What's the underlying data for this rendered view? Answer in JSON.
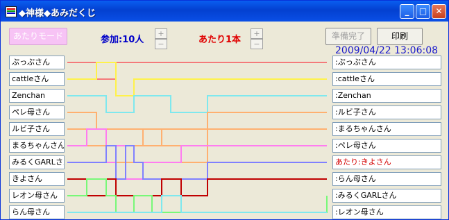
{
  "window": {
    "title": "◆神様◆あみだくじ"
  },
  "toolbar": {
    "mode_label": "あたりモード",
    "participants_label": "参加:10人",
    "winners_label": "あたり1本",
    "plus": "+",
    "minus": "−",
    "ready_label": "準備完了",
    "print_label": "印刷",
    "datetime": "2009/04/22 13:06:08"
  },
  "left_names": [
    "ぷっぷさん",
    "cattleさん",
    "Zenchan",
    "ペレ母さん",
    "ルビ子さん",
    "まるちゃんさん",
    "みるくGARLさん",
    "きよさん",
    "レオン母さん",
    "らん母さん"
  ],
  "right_results": [
    ":ぷっぷさん",
    ":cattleさん",
    ":Zenchan",
    ":ルビ子さん",
    ":まるちゃんさん",
    ":ペレ母さん",
    "あたり:きよさん",
    ":らん母さん",
    ":みるくGARLさん",
    ":レオン母さん"
  ],
  "winner_color": "#d40000",
  "line_colors": [
    "#f47a7a",
    "#fff24a",
    "#7ee8ee",
    "#ffb070",
    "#ffb070",
    "#ff7cf0",
    "#8080ff",
    "#c00000",
    "#78f878",
    "#7ee8ee"
  ]
}
